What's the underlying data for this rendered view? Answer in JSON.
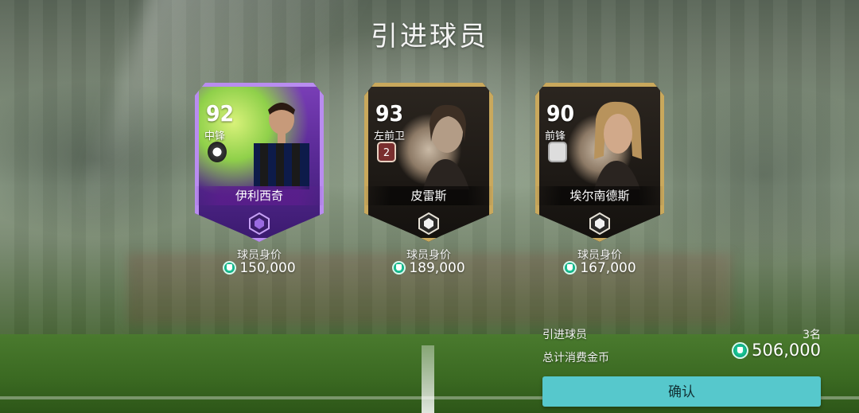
{
  "screen": {
    "title": "引进球员"
  },
  "players": [
    {
      "rating": "92",
      "position": "中锋",
      "name": "伊利西奇",
      "card_style": "purple",
      "price_label": "球员身价",
      "price": "150,000"
    },
    {
      "rating": "93",
      "position": "左前卫",
      "name": "皮雷斯",
      "card_style": "gold",
      "badge_number": "2",
      "price_label": "球员身价",
      "price": "189,000"
    },
    {
      "rating": "90",
      "position": "前锋",
      "name": "埃尔南德斯",
      "card_style": "gold",
      "price_label": "球员身价",
      "price": "167,000"
    }
  ],
  "summary": {
    "players_label": "引进球员",
    "players_count": "3名",
    "total_label": "总计消费金币",
    "total_value": "506,000"
  },
  "actions": {
    "confirm_label": "确认"
  },
  "colors": {
    "accent": "#56c8cc",
    "coin": "#0ca57d",
    "purple_card": "#7b3fb8",
    "gold_card": "#c9a85c"
  }
}
